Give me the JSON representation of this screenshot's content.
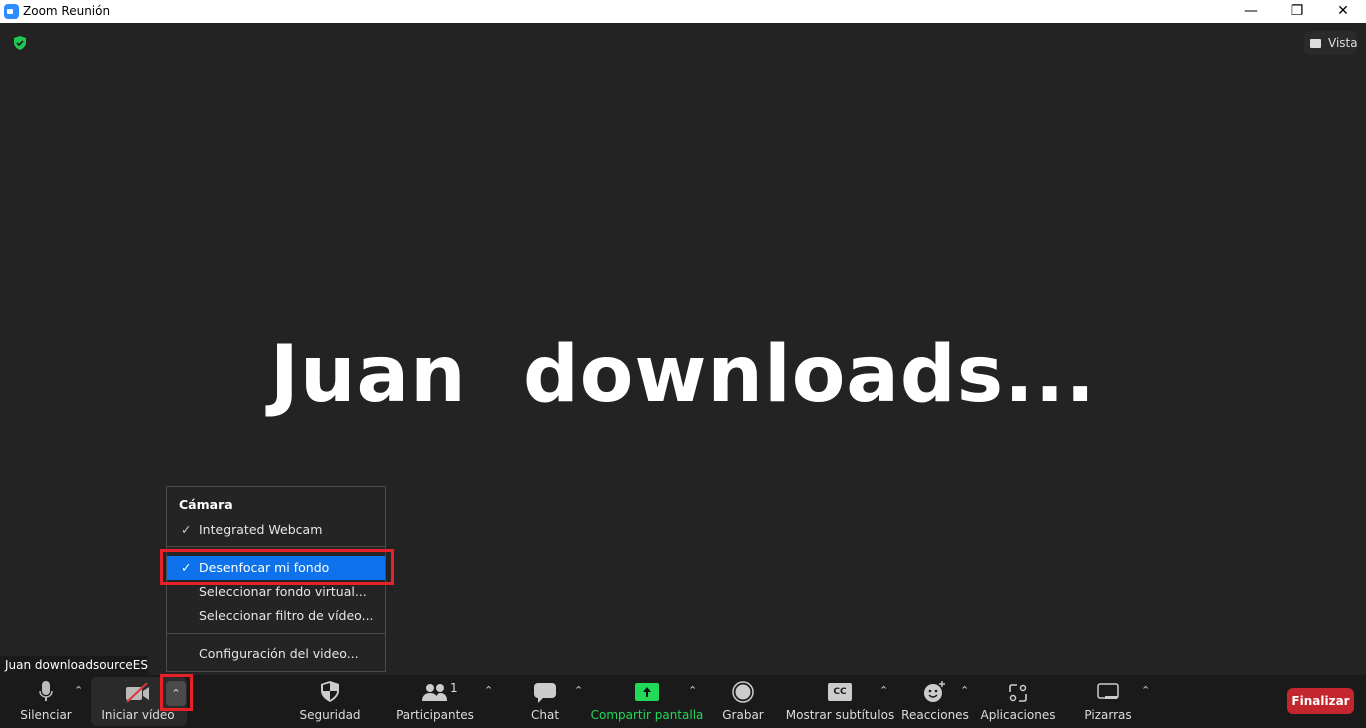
{
  "window": {
    "title": "Zoom Reunión",
    "minimize": "—",
    "restore": "❐",
    "close": "✕"
  },
  "header": {
    "view_label": "Vista"
  },
  "main": {
    "participant_display_name": "Juan  downloads...",
    "name_label": "Juan downloadsourceES"
  },
  "camera_menu": {
    "header": "Cámara",
    "items": [
      {
        "label": "Integrated Webcam",
        "checked": true
      },
      {
        "label": "Desenfocar mi fondo",
        "checked": true,
        "highlighted": true
      },
      {
        "label": "Seleccionar fondo virtual..."
      },
      {
        "label": "Seleccionar filtro de vídeo..."
      },
      {
        "label": "Configuración del video..."
      }
    ],
    "check": "✓"
  },
  "toolbar": {
    "mute": "Silenciar",
    "video": "Iniciar vídeo",
    "security": "Seguridad",
    "participants": "Participantes",
    "participants_count": "1",
    "chat": "Chat",
    "share": "Compartir pantalla",
    "record": "Grabar",
    "captions": "Mostrar subtítulos",
    "captions_badge": "CC",
    "reactions": "Reacciones",
    "apps": "Aplicaciones",
    "whiteboards": "Pizarras",
    "end": "Finalizar",
    "caret": "⌃"
  },
  "colors": {
    "accent": "#0e72ed",
    "share": "#23d959",
    "end": "#c3262c",
    "highlight_box": "#e8202a",
    "security_ok": "#23c552"
  }
}
